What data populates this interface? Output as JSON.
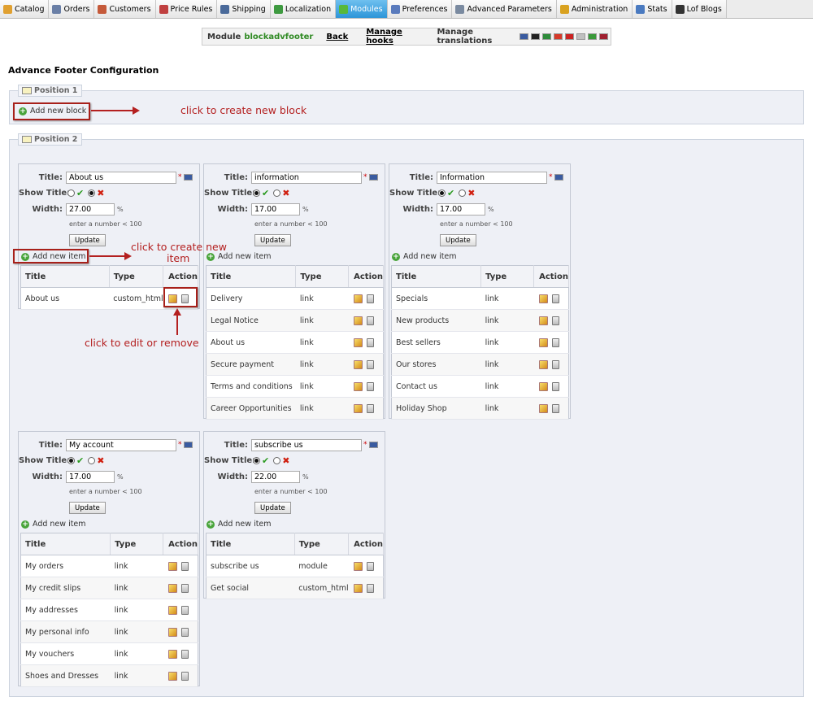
{
  "nav": [
    {
      "label": "Catalog",
      "icon": "catalog-icon",
      "color": "#e0a030"
    },
    {
      "label": "Orders",
      "icon": "cart-icon",
      "color": "#6a7fa6"
    },
    {
      "label": "Customers",
      "icon": "customers-icon",
      "color": "#c55a3a"
    },
    {
      "label": "Price Rules",
      "icon": "price-rules-icon",
      "color": "#c04040"
    },
    {
      "label": "Shipping",
      "icon": "truck-icon",
      "color": "#4a6a9a"
    },
    {
      "label": "Localization",
      "icon": "globe-icon",
      "color": "#3e9a40"
    },
    {
      "label": "Modules",
      "icon": "puzzle-icon",
      "color": "#58b83a",
      "active": true
    },
    {
      "label": "Preferences",
      "icon": "preferences-icon",
      "color": "#5a7bbd"
    },
    {
      "label": "Advanced Parameters",
      "icon": "tools-icon",
      "color": "#7a8aa0"
    },
    {
      "label": "Administration",
      "icon": "key-icon",
      "color": "#d9a220"
    },
    {
      "label": "Stats",
      "icon": "stats-icon",
      "color": "#4a7ac0"
    },
    {
      "label": "Lof Blogs",
      "icon": "user-icon",
      "color": "#333333"
    }
  ],
  "module_bar": {
    "module_label": "Module",
    "module_name": "blockadvfooter",
    "back": "Back",
    "manage_hooks": "Manage hooks",
    "manage_translations": "Manage translations"
  },
  "page_title": "Advance Footer Configuration",
  "positions": [
    {
      "legend": "Position 1"
    },
    {
      "legend": "Position 2"
    }
  ],
  "add_block": "Add new block",
  "annotations": {
    "create_block": "click to create new block",
    "create_item_1": "click to create new",
    "create_item_2": "item",
    "edit_remove": "click to edit or remove"
  },
  "labels": {
    "title": "Title:",
    "show_title": "Show Title:",
    "width": "Width:",
    "hint": "enter a number < 100",
    "update": "Update",
    "add_item": "Add new item",
    "col_title": "Title",
    "col_type": "Type",
    "col_action": "Action",
    "required": "*",
    "percent": "%"
  },
  "blocks": [
    {
      "title": "About us",
      "show_title": false,
      "width": "27.00",
      "items": [
        {
          "title": "About us",
          "type": "custom_html"
        }
      ]
    },
    {
      "title": "information",
      "show_title": true,
      "width": "17.00",
      "items": [
        {
          "title": "Delivery",
          "type": "link"
        },
        {
          "title": "Legal Notice",
          "type": "link"
        },
        {
          "title": "About us",
          "type": "link"
        },
        {
          "title": "Secure payment",
          "type": "link"
        },
        {
          "title": "Terms and conditions",
          "type": "link"
        },
        {
          "title": "Career Opportunities",
          "type": "link"
        }
      ]
    },
    {
      "title": "Information",
      "show_title": true,
      "width": "17.00",
      "items": [
        {
          "title": "Specials",
          "type": "link"
        },
        {
          "title": "New products",
          "type": "link"
        },
        {
          "title": "Best sellers",
          "type": "link"
        },
        {
          "title": "Our stores",
          "type": "link"
        },
        {
          "title": "Contact us",
          "type": "link"
        },
        {
          "title": "Holiday Shop",
          "type": "link"
        }
      ]
    },
    {
      "title": "My account",
      "show_title": true,
      "width": "17.00",
      "items": [
        {
          "title": "My orders",
          "type": "link"
        },
        {
          "title": "My credit slips",
          "type": "link"
        },
        {
          "title": "My addresses",
          "type": "link"
        },
        {
          "title": "My personal info",
          "type": "link"
        },
        {
          "title": "My vouchers",
          "type": "link"
        },
        {
          "title": "Shoes and Dresses",
          "type": "link"
        }
      ]
    },
    {
      "title": "subscribe us",
      "show_title": true,
      "width": "22.00",
      "items": [
        {
          "title": "subscribe us",
          "type": "module"
        },
        {
          "title": "Get social",
          "type": "custom_html"
        }
      ]
    }
  ],
  "flags": [
    "#3a5ba0",
    "#222222",
    "#2e8b3a",
    "#d63a2a",
    "#cc2222",
    "#c0c0c0",
    "#3a9a3a",
    "#a02030"
  ]
}
